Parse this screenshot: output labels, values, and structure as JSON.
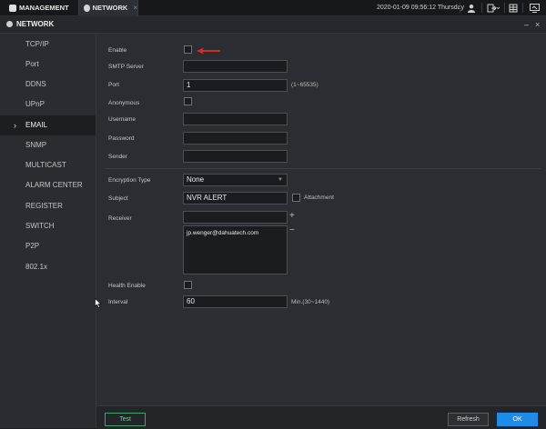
{
  "topbar": {
    "tabs": [
      {
        "label": "MANAGEMENT"
      },
      {
        "label": "NETWORK",
        "close": "×"
      }
    ],
    "datetime": "2020-01-09 09:56:12 Thursday",
    "icons": [
      "user-icon",
      "logout-icon",
      "grid-icon",
      "monitor-icon"
    ]
  },
  "titlebar": {
    "title": "NETWORK",
    "window_controls": [
      "–",
      "×"
    ]
  },
  "sidebar": {
    "items": [
      {
        "label": "TCP/IP"
      },
      {
        "label": "Port"
      },
      {
        "label": "DDNS"
      },
      {
        "label": "UPnP"
      },
      {
        "label": "EMAIL",
        "active": true
      },
      {
        "label": "SNMP"
      },
      {
        "label": "MULTICAST"
      },
      {
        "label": "ALARM CENTER"
      },
      {
        "label": "REGISTER"
      },
      {
        "label": "SWITCH"
      },
      {
        "label": "P2P"
      },
      {
        "label": "802.1x"
      }
    ]
  },
  "form": {
    "enable_label": "Enable",
    "smtp_label": "SMTP Server",
    "smtp_value": "",
    "port_label": "Port",
    "port_value": "1",
    "port_hint": "(1~65535)",
    "anonymous_label": "Anonymous",
    "username_label": "Username",
    "username_value": "",
    "password_label": "Password",
    "password_value": "",
    "sender_label": "Sender",
    "sender_value": "",
    "encryption_label": "Encryption Type",
    "encryption_value": "None",
    "subject_label": "Subject",
    "subject_value": "NVR ALERT",
    "attachment_label": "Attachment",
    "receiver_label": "Receiver",
    "receiver_input": "",
    "receiver_list": [
      "jp.wenger@dahuatech.com"
    ],
    "add_symbol": "+",
    "remove_symbol": "−",
    "health_label": "Health Enable",
    "interval_label": "Interval",
    "interval_value": "60",
    "interval_hint": "Min.(30~1440)"
  },
  "buttons": {
    "test": "Test",
    "refresh": "Refresh",
    "ok": "OK"
  },
  "colors": {
    "accent": "#1e8be8",
    "test_green": "#3fa46a",
    "annotation_arrow": "#d32a2a"
  }
}
